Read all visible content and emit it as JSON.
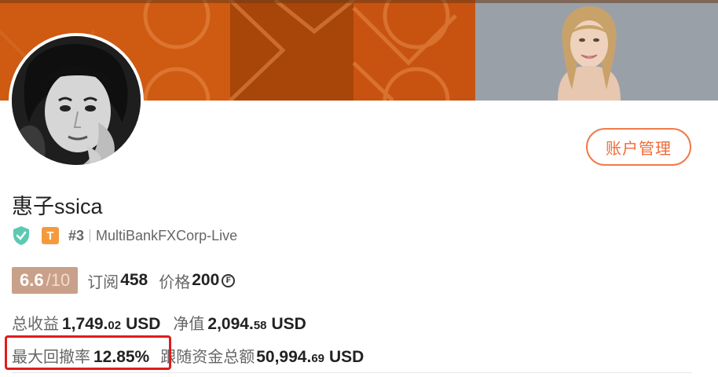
{
  "banner": {
    "panel_colors": [
      "#cf5a12",
      "#a84509",
      "#c85310",
      "#9aa0a8"
    ]
  },
  "profile": {
    "name": "惠子ssica",
    "badge_letter": "T",
    "rank": "#3",
    "broker": "MultiBankFXCorp-Live",
    "account_button": "账户管理"
  },
  "stats": {
    "score": "6.6",
    "score_max": "/10",
    "subscribe_label": "订阅",
    "subscribe_value": "458",
    "price_label": "价格",
    "price_value": "200",
    "price_currency_icon": "₣",
    "total_profit_label": "总收益",
    "total_profit_main": "1,749.",
    "total_profit_dec": "02",
    "total_profit_unit": "USD",
    "net_value_label": "净值",
    "net_value_main": "2,094.",
    "net_value_dec": "58",
    "net_value_unit": "USD",
    "max_drawdown_label": "最大回撤率",
    "max_drawdown_value": "12.85%",
    "follow_funds_label": "跟随资金总额",
    "follow_funds_main": "50,994.",
    "follow_funds_dec": "69",
    "follow_funds_unit": "USD"
  },
  "colors": {
    "accent": "#f06a38",
    "highlight": "#e01c1c",
    "score_bg": "#c9a089",
    "badge": "#f59a3c",
    "verified": "#5ec9b2"
  }
}
